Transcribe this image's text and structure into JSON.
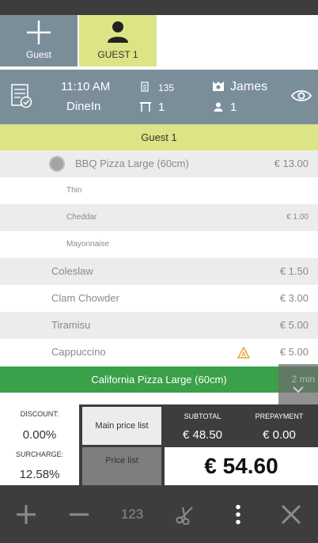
{
  "tabs": {
    "add_label": "Guest",
    "guest1_label": "GUEST 1"
  },
  "header": {
    "time": "11:10 AM",
    "order_type": "DineIn",
    "order_number": "135",
    "table_number": "1",
    "waiter": "James",
    "guests": "1"
  },
  "guest_section": "Guest 1",
  "items": [
    {
      "name": "BBQ Pizza Large (60cm)",
      "price": "€ 13.00"
    },
    {
      "name": "Thin",
      "price": ""
    },
    {
      "name": "Cheddar",
      "price": "€ 1.00"
    },
    {
      "name": "Mayonnaise",
      "price": ""
    },
    {
      "name": "Coleslaw",
      "price": "€ 1.50"
    },
    {
      "name": "Clam Chowder",
      "price": "€ 3.00"
    },
    {
      "name": "Tiramisu",
      "price": "€ 5.00"
    },
    {
      "name": "Cappuccino",
      "price": "€ 5.00"
    }
  ],
  "active_item": {
    "name": "California Pizza Large (60cm)",
    "timer": "2 min"
  },
  "totals": {
    "discount_label": "DISCOUNT:",
    "discount_value": "0.00%",
    "surcharge_label": "SURCHARGE:",
    "surcharge_value": "12.58%",
    "main_price_list": "Main price list",
    "price_list": "Price list",
    "subtotal_label": "SUBTOTAL",
    "subtotal_value": "€ 48.50",
    "prepayment_label": "PREPAYMENT",
    "prepayment_value": "€ 0.00",
    "grand_total": "€ 54.60"
  },
  "toolbar": {
    "numpad_label": "123"
  },
  "colors": {
    "header": "#7a8e9a",
    "guest_highlight": "#dde485",
    "active_green": "#3aa04a",
    "dark": "#3d3d3d",
    "warning": "#e8a33a"
  }
}
